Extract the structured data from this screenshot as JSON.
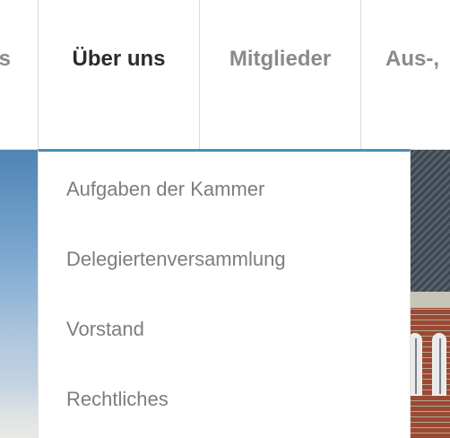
{
  "nav": {
    "items": [
      {
        "label": "s"
      },
      {
        "label": "Über uns"
      },
      {
        "label": "Mitglieder"
      },
      {
        "label": "Aus-,"
      }
    ],
    "active_index": 1,
    "active_color": "#2b2b2b",
    "inactive_color": "#8a8a8a"
  },
  "dropdown": {
    "accent_color": "#4a8fba",
    "items": [
      {
        "label": "Aufgaben der Kammer"
      },
      {
        "label": "Delegiertenversammlung"
      },
      {
        "label": "Vorstand"
      },
      {
        "label": "Rechtliches"
      }
    ]
  }
}
